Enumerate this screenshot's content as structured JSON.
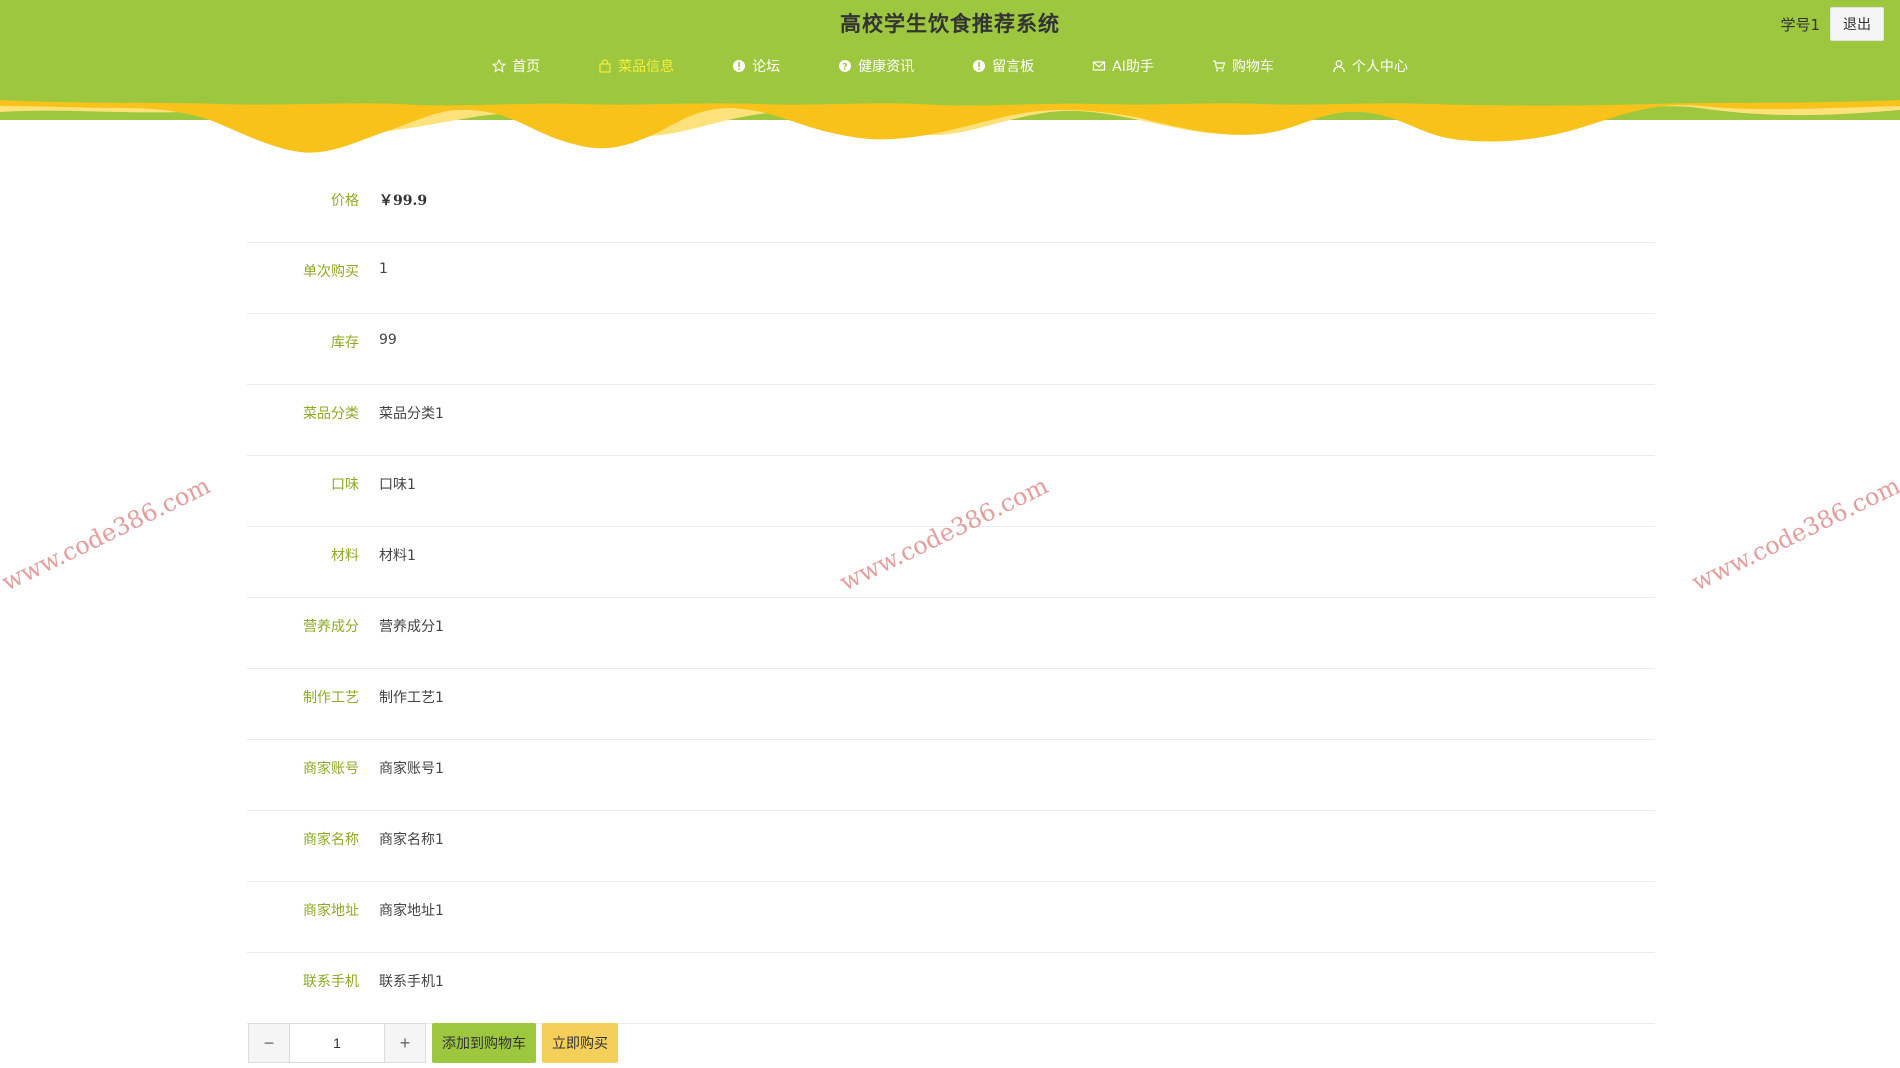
{
  "header": {
    "site_title": "高校学生饮食推荐系统",
    "username": "学号1",
    "logout_label": "退出",
    "brand_color": "#9dc73f",
    "accent_color": "#f7ed38"
  },
  "nav": {
    "items": [
      {
        "label": "首页",
        "icon": "star-icon"
      },
      {
        "label": "菜品信息",
        "icon": "bag-icon",
        "active": true
      },
      {
        "label": "论坛",
        "icon": "info-icon"
      },
      {
        "label": "健康资讯",
        "icon": "question-icon"
      },
      {
        "label": "留言板",
        "icon": "info-icon"
      },
      {
        "label": "AI助手",
        "icon": "mail-icon"
      },
      {
        "label": "购物车",
        "icon": "cart-icon"
      },
      {
        "label": "个人中心",
        "icon": "user-icon"
      }
    ]
  },
  "detail": {
    "rows": [
      {
        "label": "价格",
        "value": "￥99.9"
      },
      {
        "label": "单次购买",
        "value": "1"
      },
      {
        "label": "库存",
        "value": "99"
      },
      {
        "label": "菜品分类",
        "value": "菜品分类1"
      },
      {
        "label": "口味",
        "value": "口味1"
      },
      {
        "label": "材料",
        "value": "材料1"
      },
      {
        "label": "营养成分",
        "value": "营养成分1"
      },
      {
        "label": "制作工艺",
        "value": "制作工艺1"
      },
      {
        "label": "商家账号",
        "value": "商家账号1"
      },
      {
        "label": "商家名称",
        "value": "商家名称1"
      },
      {
        "label": "商家地址",
        "value": "商家地址1"
      },
      {
        "label": "联系手机",
        "value": "联系手机1"
      }
    ]
  },
  "actions": {
    "minus": "−",
    "quantity": "1",
    "plus": "+",
    "add_to_cart": "添加到购物车",
    "buy_now": "立即购买"
  },
  "watermark": {
    "text": "www.code386.com"
  }
}
